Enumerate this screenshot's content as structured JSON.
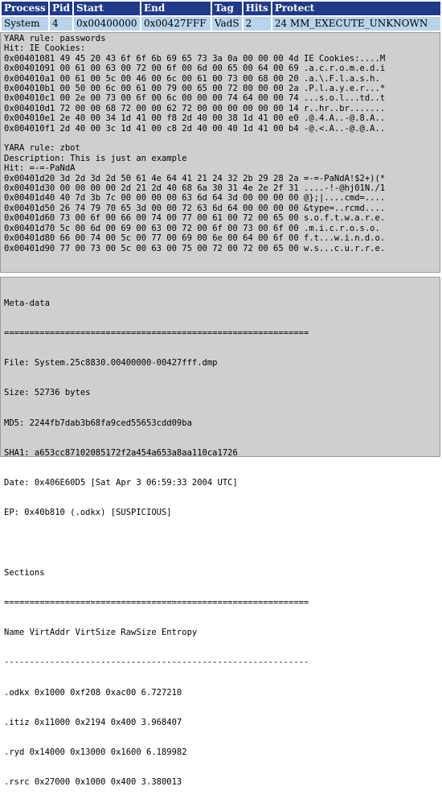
{
  "vad_table": {
    "headers": [
      "Process",
      "Pid",
      "Start",
      "End",
      "Tag",
      "Hits",
      "Protect"
    ],
    "row": [
      "System",
      "4",
      "0x00400000",
      "0x00427FFF",
      "VadS",
      "2",
      "24 MM_EXECUTE_UNKNOWN"
    ]
  },
  "yara_hits": [
    {
      "rule_line": "YARA rule: passwords",
      "description_line": "",
      "hit_line": "Hit: IE Cookies:",
      "rows": [
        {
          "addr": "0x00401081",
          "bytes": "49 45 20 43 6f 6f 6b 69 65 73 3a 0a 00 00 00 4d",
          "ascii": "IE Cookies:....M"
        },
        {
          "addr": "0x00401091",
          "bytes": "00 61 00 63 00 72 00 6f 00 6d 00 65 00 64 00 69",
          "ascii": ".a.c.r.o.m.e.d.i"
        },
        {
          "addr": "0x004010a1",
          "bytes": "00 61 00 5c 00 46 00 6c 00 61 00 73 00 68 00 20",
          "ascii": ".a.\\.F.l.a.s.h. "
        },
        {
          "addr": "0x004010b1",
          "bytes": "00 50 00 6c 00 61 00 79 00 65 00 72 00 00 00 2a",
          "ascii": ".P.l.a.y.e.r...*"
        },
        {
          "addr": "0x004010c1",
          "bytes": "00 2e 00 73 00 6f 00 6c 00 00 00 74 64 00 00 74",
          "ascii": "...s.o.l...td..t"
        },
        {
          "addr": "0x004010d1",
          "bytes": "72 00 00 68 72 00 00 62 72 00 00 00 00 00 00 14",
          "ascii": "r..hr..br......."
        },
        {
          "addr": "0x004010e1",
          "bytes": "2e 40 00 34 1d 41 00 f8 2d 40 00 38 1d 41 00 e0",
          "ascii": ".@.4.A..-@.8.A.."
        },
        {
          "addr": "0x004010f1",
          "bytes": "2d 40 00 3c 1d 41 00 c8 2d 40 00 40 1d 41 00 b4",
          "ascii": "-@.<.A..-@.@.A.."
        }
      ]
    },
    {
      "rule_line": "YARA rule: zbot",
      "description_line": "Description: This is just an example",
      "hit_line": "Hit: =-=-PaNdA",
      "rows": [
        {
          "addr": "0x00401d20",
          "bytes": "3d 2d 3d 2d 50 61 4e 64 41 21 24 32 2b 29 28 2a",
          "ascii": "=-=-PaNdA!$2+)(*"
        },
        {
          "addr": "0x00401d30",
          "bytes": "00 00 00 00 2d 21 2d 40 68 6a 30 31 4e 2e 2f 31",
          "ascii": "....-!-@hj01N./1"
        },
        {
          "addr": "0x00401d40",
          "bytes": "40 7d 3b 7c 00 00 00 00 63 6d 64 3d 00 00 00 00",
          "ascii": "@};|....cmd=...."
        },
        {
          "addr": "0x00401d50",
          "bytes": "26 74 79 70 65 3d 00 00 72 63 6d 64 00 00 00 00",
          "ascii": "&type=..rcmd...."
        },
        {
          "addr": "0x00401d60",
          "bytes": "73 00 6f 00 66 00 74 00 77 00 61 00 72 00 65 00",
          "ascii": "s.o.f.t.w.a.r.e."
        },
        {
          "addr": "0x00401d70",
          "bytes": "5c 00 6d 00 69 00 63 00 72 00 6f 00 73 00 6f 00",
          "ascii": ".m.i.c.r.o.s.o."
        },
        {
          "addr": "0x00401d80",
          "bytes": "66 00 74 00 5c 00 77 00 69 00 6e 00 64 00 6f 00",
          "ascii": "f.t...w.i.n.d.o."
        },
        {
          "addr": "0x00401d90",
          "bytes": "77 00 73 00 5c 00 63 00 75 00 72 00 72 00 65 00",
          "ascii": "w.s...c.u.r.r.e."
        }
      ]
    }
  ],
  "metadata": {
    "heading": "Meta-data",
    "separator": "============================================================",
    "lines": [
      "File: System.25c8830.00400000-00427fff.dmp",
      "Size: 52736 bytes",
      "MD5: 2244fb7dab3b68fa9ced55653cdd09ba",
      "SHA1: a653cc87102085172f2a454a653a8aa110ca1726",
      "Date: 0x406E60D5 [Sat Apr 3 06:59:33 2004 UTC]",
      "EP: 0x40b810 (.odkx) [SUSPICIOUS]"
    ],
    "sections_heading": "Sections",
    "sections_header": "Name VirtAddr VirtSize RawSize Entropy",
    "sections_separator": "------------------------------------------------------------",
    "sections": [
      ".odkx 0x1000 0xf208 0xac00 6.727210",
      ".itiz 0x11000 0x2194 0x400 3.968407",
      ".ryd 0x14000 0x13000 0x1600 6.189982",
      ".rsrc 0x27000 0x1000 0x400 3.380013"
    ]
  }
}
